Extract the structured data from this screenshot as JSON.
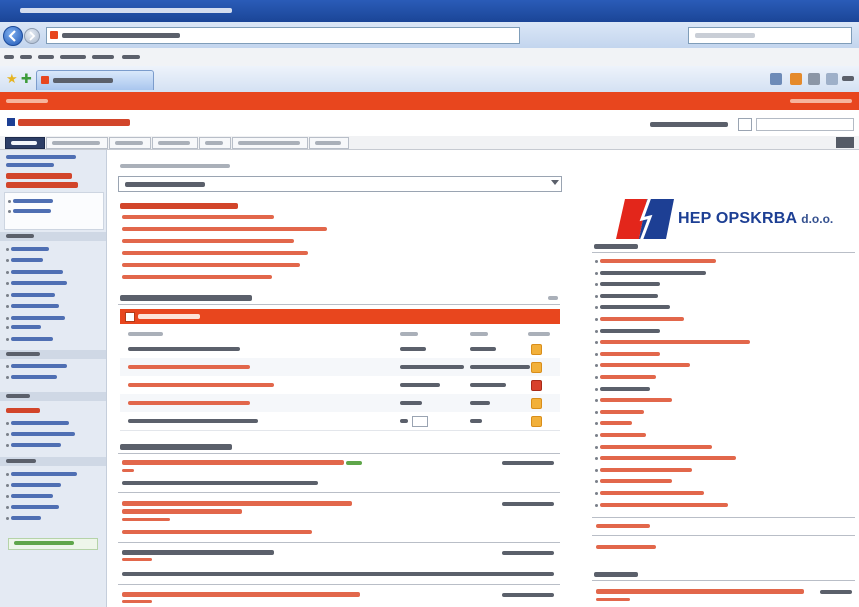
{
  "logo": {
    "name": "HEP OPSKRBA",
    "suffix": "d.o.o."
  },
  "colors": {
    "brand_orange": "#e8461e",
    "link_red": "#e2674b",
    "brand_blue": "#1d3f94",
    "logo_red": "#e3261b",
    "window_blue": "#1b4597",
    "sidebar_bg": "#e4eaf3"
  },
  "icons": {
    "browser_back": "back-arrow-icon",
    "browser_forward": "forward-arrow-icon",
    "favorites": "star-icon",
    "add_favorite": "add-favorite-icon",
    "home": "home-icon",
    "feeds": "rss-icon",
    "print": "print-icon",
    "page_menu": "page-icon",
    "status_ok": "warning-icon",
    "status_alert": "alert-icon"
  }
}
